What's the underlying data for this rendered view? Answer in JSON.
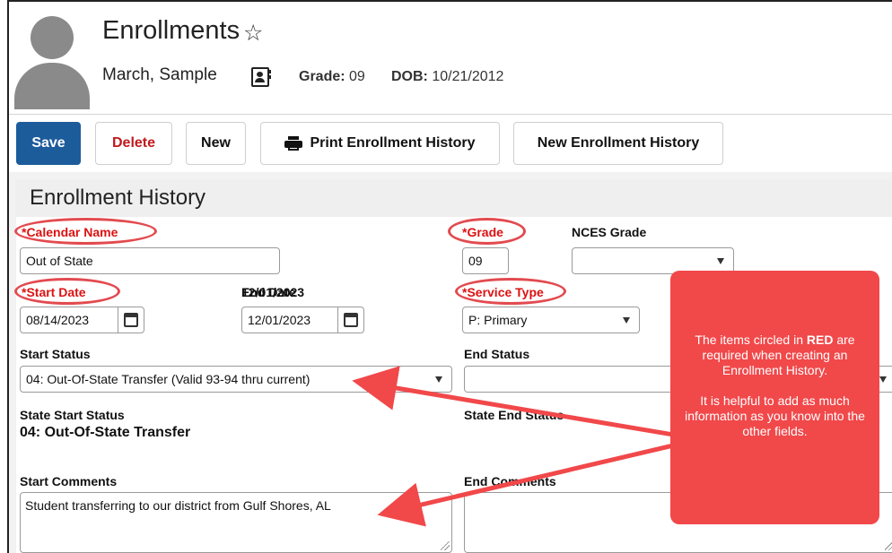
{
  "header": {
    "title": "Enrollments",
    "star_icon": "star-icon",
    "student_name": "March, Sample",
    "grade_label": "Grade:",
    "grade_value": "09",
    "dob_label": "DOB:",
    "dob_value": "10/21/2012"
  },
  "toolbar": {
    "save": "Save",
    "delete": "Delete",
    "new": "New",
    "print_history": "Print Enrollment History",
    "new_history": "New Enrollment History"
  },
  "section": {
    "title": "Enrollment History"
  },
  "fields": {
    "calendar_name": {
      "label": "*Calendar Name",
      "value": "Out of State"
    },
    "grade": {
      "label": "*Grade",
      "value": "09"
    },
    "nces_grade": {
      "label": "NCES Grade",
      "value": ""
    },
    "start_date": {
      "label": "*Start Date",
      "value": "08/14/2023"
    },
    "end_date": {
      "label": "End Date",
      "value": "12/01/2023"
    },
    "service_type": {
      "label": "*Service Type",
      "value": "P: Primary"
    },
    "start_status": {
      "label": "Start Status",
      "value": "04: Out-Of-State Transfer (Valid 93-94 thru current)"
    },
    "end_status": {
      "label": "End Status",
      "value": ""
    },
    "state_start_status": {
      "label": "State Start Status",
      "value": "04: Out-Of-State Transfer"
    },
    "state_end_status": {
      "label": "State End Status",
      "value": ""
    },
    "start_comments": {
      "label": "Start Comments",
      "value": "Student transferring to our district from Gulf Shores, AL"
    },
    "end_comments": {
      "label": "End Comments",
      "value": ""
    }
  },
  "callout": {
    "line1_pre": "The items circled in ",
    "line1_red": "RED",
    "line1_post": " are required when creating an Enrollment History.",
    "line2": "It is helpful to add as much information as you know into the other fields."
  },
  "colors": {
    "save_button": "#1d5c9b",
    "delete_text": "#c0191e",
    "required_label": "#dd1111",
    "ring": "#e24a4f",
    "callout_bg": "#f1484a"
  }
}
